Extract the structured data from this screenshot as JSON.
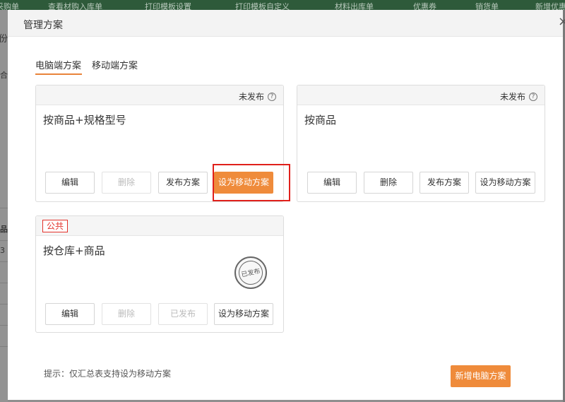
{
  "background": {
    "topbar_items": [
      "采购单",
      "查看材购入库单",
      "打印模板设置",
      "打印模板自定义",
      "材料出库单",
      "优惠券",
      "销货单",
      "新增优惠"
    ],
    "left_fragments": [
      "份)",
      "合",
      "品牌",
      "3"
    ]
  },
  "modal": {
    "title": "管理方案",
    "close_glyph": "×"
  },
  "tabs": [
    {
      "label": "电脑端方案",
      "active": true
    },
    {
      "label": "移动端方案",
      "active": false
    }
  ],
  "cards": [
    {
      "name": "按商品+规格型号",
      "status": "未发布",
      "tag": "",
      "buttons": {
        "edit": "编辑",
        "delete": "删除",
        "publish": "发布方案",
        "mobile": "设为移动方案"
      }
    },
    {
      "name": "按商品",
      "status": "未发布",
      "tag": "",
      "buttons": {
        "edit": "编辑",
        "delete": "删除",
        "publish": "发布方案",
        "mobile": "设为移动方案"
      }
    },
    {
      "name": "按仓库+商品",
      "status": "",
      "tag": "公共",
      "stamp": "已发布",
      "buttons": {
        "edit": "编辑",
        "delete": "删除",
        "publish": "已发布",
        "mobile": "设为移动方案"
      }
    }
  ],
  "tip": "提示：仅汇总表支持设为移动方案",
  "new_button": "新增电脑方案",
  "help_glyph": "?",
  "colors": {
    "accent": "#ef8b3b",
    "highlight": "#e0201b",
    "tag": "#e3312a"
  }
}
